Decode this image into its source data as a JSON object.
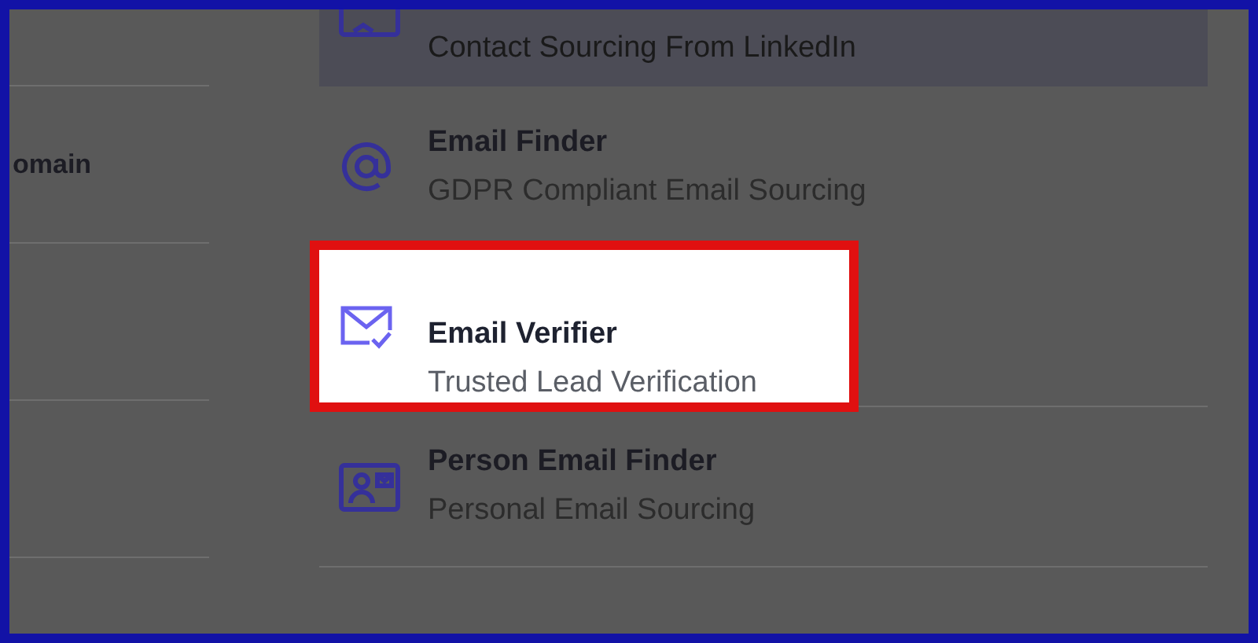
{
  "left_column": {
    "rows": [
      {
        "label": null
      },
      {
        "label": "omain"
      },
      {
        "label": null
      },
      {
        "label": null
      }
    ]
  },
  "menu": {
    "items": [
      {
        "subtitle": "Contact Sourcing From LinkedIn",
        "hovered": true,
        "highlighted": false
      },
      {
        "title": "Email Finder",
        "subtitle": "GDPR Compliant Email Sourcing",
        "hovered": false,
        "highlighted": false
      },
      {
        "title": "Email Verifier",
        "subtitle": "Trusted Lead Verification",
        "hovered": false,
        "highlighted": true
      },
      {
        "title": "Person Email Finder",
        "subtitle": "Personal Email Sourcing",
        "hovered": false,
        "highlighted": false
      }
    ]
  }
}
